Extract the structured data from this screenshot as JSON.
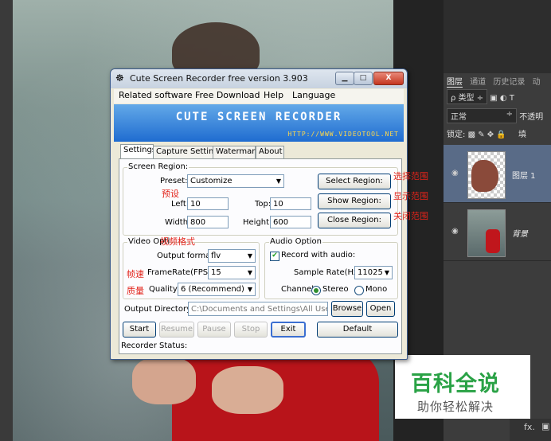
{
  "window": {
    "title": "Cute Screen Recorder free version 3.903",
    "min": "▁",
    "max": "□",
    "close": "X"
  },
  "menu": [
    "Related software",
    "Free Download",
    "Help",
    "Language"
  ],
  "banner": {
    "title": "CUTE SCREEN RECORDER",
    "url": "HTTP://WWW.VIDEOTOOL.NET"
  },
  "tabs": [
    "Settings",
    "Capture Settings",
    "Watermark",
    "About"
  ],
  "screen_region": {
    "title": "Screen Region:",
    "preset_label": "Preset:",
    "preset_value": "Customize",
    "left_label": "Left:",
    "left_value": "10",
    "top_label": "Top:",
    "top_value": "10",
    "width_label": "Width:",
    "width_value": "800",
    "height_label": "Height:",
    "height_value": "600",
    "select_btn": "Select Region:",
    "show_btn": "Show Region:",
    "close_btn": "Close Region:"
  },
  "video": {
    "title": "Video Opti",
    "format_label": "Output format:",
    "format_value": "flv",
    "fps_label": "FrameRate(FPS):",
    "fps_value": "15",
    "quality_label": "Quality:",
    "quality_value": "6 (Recommend)"
  },
  "audio": {
    "title": "Audio Option",
    "record_label": "Record with audio:",
    "record_checked": true,
    "rate_label": "Sample Rate(Hz):",
    "rate_value": "11025",
    "channel_label": "Channel:",
    "stereo": "Stereo",
    "mono": "Mono",
    "channel_selected": "Stereo"
  },
  "output": {
    "label": "Output Directory:",
    "value": "C:\\Documents and Settings\\All Users\\scre",
    "browse": "Browse",
    "open": "Open"
  },
  "actions": {
    "start": "Start",
    "resume": "Resume",
    "pause": "Pause",
    "stop": "Stop",
    "exit": "Exit",
    "default": "Default"
  },
  "status_label": "Recorder Status:",
  "annotations": {
    "preset": "预设",
    "video_format": "视频格式",
    "framerate": "帧速",
    "quality": "质量",
    "select": "选择范围",
    "show": "显示范围",
    "close": "关闭范围"
  },
  "photoshop": {
    "tabs": [
      "图层",
      "通道",
      "历史记录",
      "动"
    ],
    "filter_label": "ρ 类型",
    "blend_mode": "正常",
    "opacity_label": "不透明",
    "lock_label": "锁定:",
    "fill_label": "填",
    "layers": [
      {
        "name": "图层 1",
        "active": true
      },
      {
        "name": "背景",
        "active": false
      }
    ],
    "footer_label": "fx."
  },
  "watermark": {
    "line1": "百科全说",
    "line2": "助你轻松解决"
  }
}
